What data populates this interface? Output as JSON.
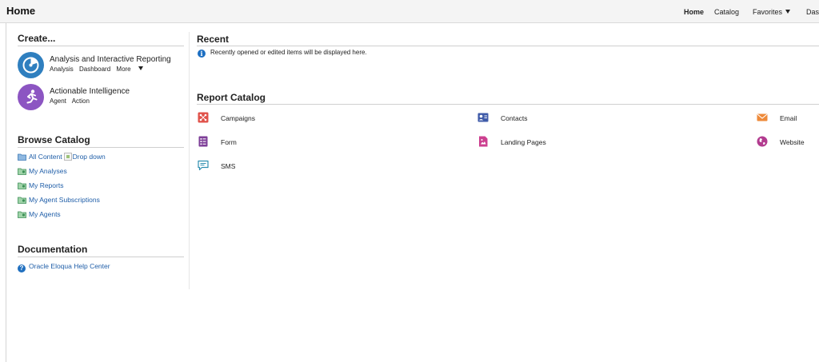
{
  "header": {
    "title": "Home",
    "nav": [
      "Home",
      "Catalog",
      "Favorites",
      "Das"
    ]
  },
  "create": {
    "title": "Create...",
    "items": [
      {
        "name": "Analysis and Interactive Reporting",
        "links": [
          "Analysis",
          "Dashboard",
          "More"
        ]
      },
      {
        "name": "Actionable Intelligence",
        "links": [
          "Agent",
          "Action"
        ]
      }
    ]
  },
  "browse": {
    "title": "Browse Catalog",
    "items": [
      "All Content",
      "My Analyses",
      "My Reports",
      "My Agent Subscriptions",
      "My Agents"
    ],
    "dropdown_alt": "Drop down"
  },
  "documentation": {
    "title": "Documentation",
    "items": [
      "Oracle Eloqua Help Center"
    ]
  },
  "recent": {
    "title": "Recent",
    "message": "Recently opened or edited items will be displayed here."
  },
  "report_catalog": {
    "title": "Report Catalog",
    "items": [
      "Campaigns",
      "Contacts",
      "Email",
      "Form",
      "Landing Pages",
      "Website",
      "SMS"
    ]
  },
  "colors": {
    "link": "#1f5ea8",
    "analysis_icon": "#2f7fbf",
    "intelligence_icon": "#8c55c2",
    "campaigns": "#e0524a",
    "contacts": "#3f5ba9",
    "email": "#ee8a3a",
    "form": "#7e3f98",
    "landing_pages": "#cc3f8f",
    "website": "#b23b8f",
    "sms": "#2f8fb0"
  }
}
